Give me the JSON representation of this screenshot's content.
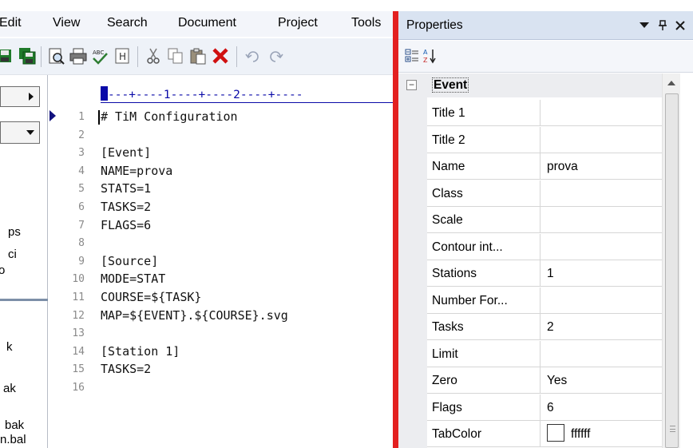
{
  "menubar": {
    "items": [
      "Edit",
      "View",
      "Search",
      "Document",
      "Project",
      "Tools"
    ]
  },
  "toolbar": {
    "icons": [
      "save-icon",
      "save-all-icon",
      "print-preview-icon",
      "print-icon",
      "spellcheck-icon",
      "format-icon",
      "cut-icon",
      "copy-icon",
      "paste-icon",
      "delete-icon",
      "undo-icon",
      "redo-icon"
    ]
  },
  "sidepanel": {
    "texts": [
      "ps",
      "ci",
      "o",
      "k",
      "ak",
      "bak",
      "n.bal"
    ]
  },
  "editor": {
    "ruler": "---+----1----+----2----+----",
    "lines": [
      {
        "num": "1",
        "text": "# TiM Configuration"
      },
      {
        "num": "2",
        "text": ""
      },
      {
        "num": "3",
        "text": "[Event]"
      },
      {
        "num": "4",
        "text": "NAME=prova"
      },
      {
        "num": "5",
        "text": "STATS=1"
      },
      {
        "num": "6",
        "text": "TASKS=2"
      },
      {
        "num": "7",
        "text": "FLAGS=6"
      },
      {
        "num": "8",
        "text": ""
      },
      {
        "num": "9",
        "text": "[Source]"
      },
      {
        "num": "10",
        "text": "MODE=STAT"
      },
      {
        "num": "11",
        "text": "COURSE=${TASK}"
      },
      {
        "num": "12",
        "text": "MAP=${EVENT}.${COURSE}.svg"
      },
      {
        "num": "13",
        "text": ""
      },
      {
        "num": "14",
        "text": "[Station 1]"
      },
      {
        "num": "15",
        "text": "TASKS=2"
      },
      {
        "num": "16",
        "text": ""
      }
    ]
  },
  "properties": {
    "title": "Properties",
    "pin_glyph": "ᵖ",
    "close_glyph": "✕",
    "category": {
      "label": "Event",
      "toggle": "⊟"
    },
    "rows": [
      {
        "name": "Title 1",
        "value": ""
      },
      {
        "name": "Title 2",
        "value": ""
      },
      {
        "name": "Name",
        "value": "prova"
      },
      {
        "name": "Class",
        "value": ""
      },
      {
        "name": "Scale",
        "value": ""
      },
      {
        "name": "Contour int...",
        "value": ""
      },
      {
        "name": "Stations",
        "value": "1"
      },
      {
        "name": "Number For...",
        "value": ""
      },
      {
        "name": "Tasks",
        "value": "2"
      },
      {
        "name": "Limit",
        "value": ""
      },
      {
        "name": "Zero",
        "value": "Yes"
      },
      {
        "name": "Flags",
        "value": "6"
      },
      {
        "name": "TabColor",
        "value": "ffffff",
        "swatch_color": "#ffffff"
      }
    ]
  },
  "colors": {
    "divider": "#e32020",
    "ruler": "#0a0aa8",
    "panel_title_bg": "#d9e3f1"
  }
}
